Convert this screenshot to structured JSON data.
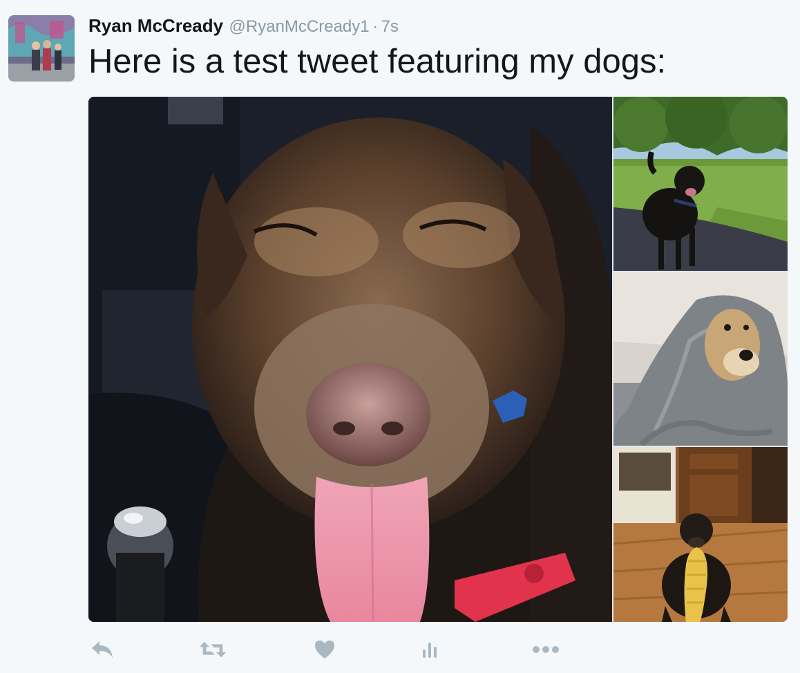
{
  "tweet": {
    "author_name": "Ryan McCready",
    "author_handle": "@RyanMcCready1",
    "separator": "·",
    "timestamp": "7s",
    "text": "Here is a test tweet featuring my dogs:"
  },
  "media": {
    "count": 4,
    "items": [
      "dog-closeup-photo",
      "dog-on-path-photo",
      "dog-in-blanket-photo",
      "dog-with-treat-photo"
    ]
  },
  "actions": [
    {
      "name": "reply",
      "icon": "reply-icon"
    },
    {
      "name": "retweet",
      "icon": "retweet-icon"
    },
    {
      "name": "like",
      "icon": "heart-icon"
    },
    {
      "name": "analytics",
      "icon": "analytics-icon"
    },
    {
      "name": "more",
      "icon": "more-icon"
    }
  ],
  "colors": {
    "background": "#f5f8fa",
    "text": "#14171a",
    "secondary": "#8899a6",
    "icon": "#aab8c2"
  }
}
